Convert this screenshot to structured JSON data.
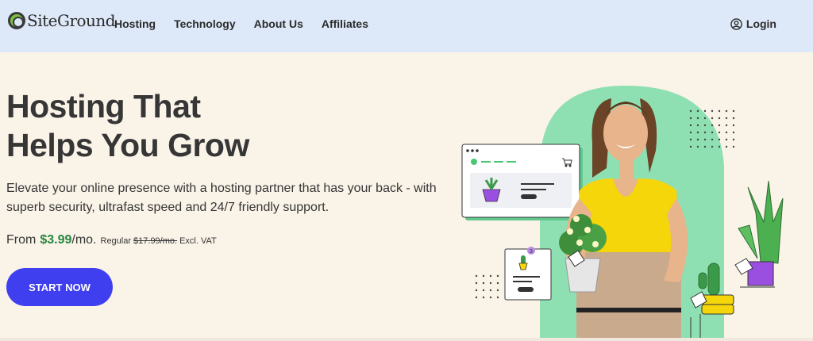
{
  "header": {
    "logo_text": "SiteGround",
    "nav": [
      "Hosting",
      "Technology",
      "About Us",
      "Affiliates"
    ],
    "login_label": "Login"
  },
  "hero": {
    "headline_line1": "Hosting That",
    "headline_line2": "Helps You Grow",
    "subtext": "Elevate your online presence with a hosting partner that has your back - with superb security, ultrafast speed and 24/7 friendly support.",
    "price_from": "From",
    "price_amount": "$3.99",
    "price_unit": "/mo.",
    "price_regular_label": "Regular",
    "price_regular_old": "$17.99/mo.",
    "price_vat": "Excl. VAT",
    "cta_label": "START NOW",
    "card_badge_count": "3"
  },
  "colors": {
    "header_bg": "#dde9f9",
    "page_bg": "#faf3e8",
    "accent_green": "#25873e",
    "cta_blue": "#3f3ff0",
    "mint": "#8ee0b2",
    "purple": "#9b4fe0",
    "yellow": "#f5d60b"
  },
  "icons": [
    "logo-icon",
    "user-circle-icon",
    "cart-icon",
    "plant-icon",
    "cactus-icon",
    "price-tag-icon"
  ]
}
